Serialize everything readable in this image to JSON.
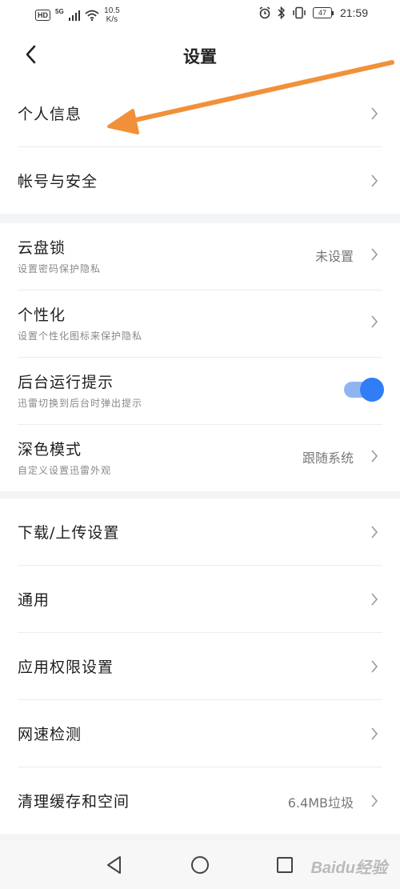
{
  "status_bar": {
    "hd": "HD",
    "network": "5G",
    "speed_value": "10.5",
    "speed_unit": "K/s",
    "battery": "47",
    "time": "21:59"
  },
  "header": {
    "title": "设置"
  },
  "groups": [
    {
      "rows": [
        {
          "title": "个人信息"
        },
        {
          "title": "帐号与安全"
        }
      ]
    },
    {
      "rows": [
        {
          "title": "云盘锁",
          "subtitle": "设置密码保护隐私",
          "value": "未设置"
        },
        {
          "title": "个性化",
          "subtitle": "设置个性化图标来保护隐私"
        },
        {
          "title": "后台运行提示",
          "subtitle": "迅雷切换到后台时弹出提示",
          "toggle_on": true
        },
        {
          "title": "深色模式",
          "subtitle": "自定义设置迅雷外观",
          "value": "跟随系统"
        }
      ]
    },
    {
      "rows": [
        {
          "title": "下载/上传设置"
        },
        {
          "title": "通用"
        },
        {
          "title": "应用权限设置"
        },
        {
          "title": "网速检测"
        },
        {
          "title": "清理缓存和空间",
          "value": "6.4MB垃圾"
        }
      ]
    }
  ],
  "watermark": "Baidu经验",
  "colors": {
    "accent": "#2f7ef5",
    "annotation_arrow": "#f0913a"
  }
}
